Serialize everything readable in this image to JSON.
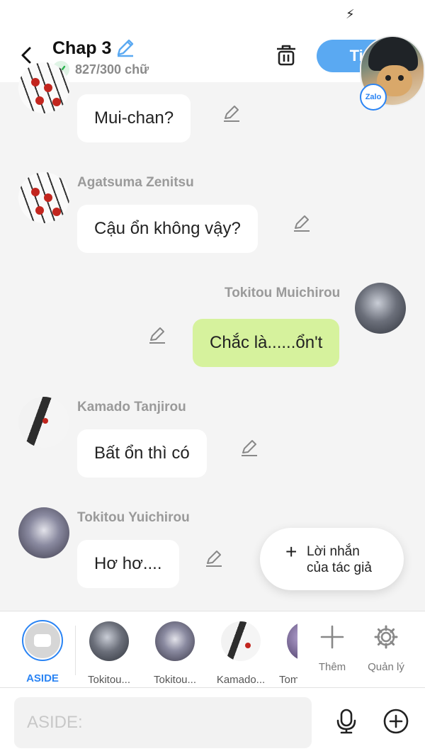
{
  "status": {
    "icon": "charging-bolt-icon",
    "bolt": "⚡"
  },
  "header": {
    "title": "Chap 3",
    "word_count": "827/300 chữ",
    "next_label": "Tiếp",
    "badge_label": "Zalo"
  },
  "messages": [
    {
      "sender": "",
      "text": "Mui-chan?",
      "side": "left"
    },
    {
      "sender": "Agatsuma Zenitsu",
      "text": "Cậu ổn không vậy?",
      "side": "left"
    },
    {
      "sender": "Tokitou Muichirou",
      "text": "Chắc là......ổn't",
      "side": "right"
    },
    {
      "sender": "Kamado Tanjirou",
      "text": "Bất ổn thì có",
      "side": "left"
    },
    {
      "sender": "Tokitou Yuichirou",
      "text": "Hơ hơ....",
      "side": "left"
    }
  ],
  "author_note": {
    "plus": "+",
    "line1": "Lời nhắn",
    "line2": "của tác giả"
  },
  "character_bar": {
    "aside_label": "ASIDE",
    "characters": [
      {
        "label": "Tokitou..."
      },
      {
        "label": "Tokitou..."
      },
      {
        "label": "Kamado..."
      },
      {
        "label": "Tom"
      }
    ],
    "add_label": "Thêm",
    "manage_label": "Quản lý"
  },
  "composer": {
    "placeholder": "ASIDE:"
  },
  "colors": {
    "accent": "#2a84f4",
    "next_button": "#5aa9f2",
    "my_bubble": "#d6f29d"
  }
}
